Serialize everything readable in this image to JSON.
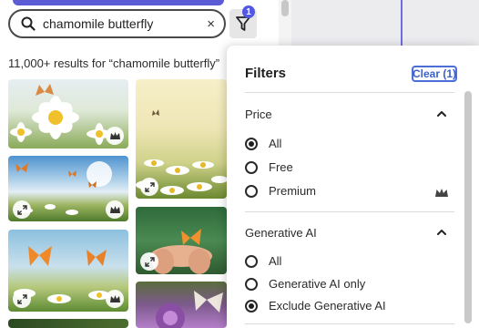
{
  "search": {
    "query": "chamomile butterfly",
    "clear_glyph": "×"
  },
  "filter_button": {
    "badge_count": "1",
    "icon": "funnel-icon"
  },
  "results": {
    "summary": "11,000+ results for “chamomile butterfly”"
  },
  "gallery": {
    "images": [
      {
        "name": "daisy-butterfly-closeup",
        "colors": [
          "#e8eef0",
          "#ffffff",
          "#f2c12e",
          "#6c8e3d"
        ],
        "badges": [
          "premium-icon"
        ]
      },
      {
        "name": "sunlit-daisy-field",
        "colors": [
          "#f6efc9",
          "#fff8dd",
          "#d8c270",
          "#5d7a2b"
        ],
        "badges": [
          "expand-icon"
        ]
      },
      {
        "name": "butterflies-sky-meadow",
        "colors": [
          "#6aa6d6",
          "#ffffff",
          "#dcebf5",
          "#5f8a39"
        ],
        "badges": [
          "expand-icon",
          "premium-icon"
        ]
      },
      {
        "name": "hands-holding-butterfly",
        "colors": [
          "#3f7f47",
          "#e8b08e",
          "#f09a3e",
          "#2d5a2f"
        ],
        "badges": [
          "expand-icon"
        ]
      },
      {
        "name": "orange-butterflies-daisies",
        "colors": [
          "#8fc3e2",
          "#ffffff",
          "#f08a2c",
          "#6b9b3e"
        ],
        "badges": [
          "expand-icon",
          "premium-icon"
        ]
      },
      {
        "name": "purple-flower-butterfly",
        "colors": [
          "#7c4b8e",
          "#c28fd0",
          "#e9e4dc",
          "#4a6a35"
        ],
        "badges": []
      },
      {
        "name": "dark-green-partial",
        "colors": [
          "#2d4a23",
          "#4d6d32"
        ],
        "badges": []
      }
    ]
  },
  "filters": {
    "title": "Filters",
    "clear_label": "Clear (1)",
    "price": {
      "title": "Price",
      "options": [
        {
          "label": "All",
          "selected": true
        },
        {
          "label": "Free",
          "selected": false
        },
        {
          "label": "Premium",
          "selected": false,
          "icon": "premium-icon"
        }
      ]
    },
    "generative_ai": {
      "title": "Generative AI",
      "options": [
        {
          "label": "All",
          "selected": false
        },
        {
          "label": "Generative AI only",
          "selected": false
        },
        {
          "label": "Exclude Generative AI",
          "selected": true
        }
      ]
    }
  }
}
